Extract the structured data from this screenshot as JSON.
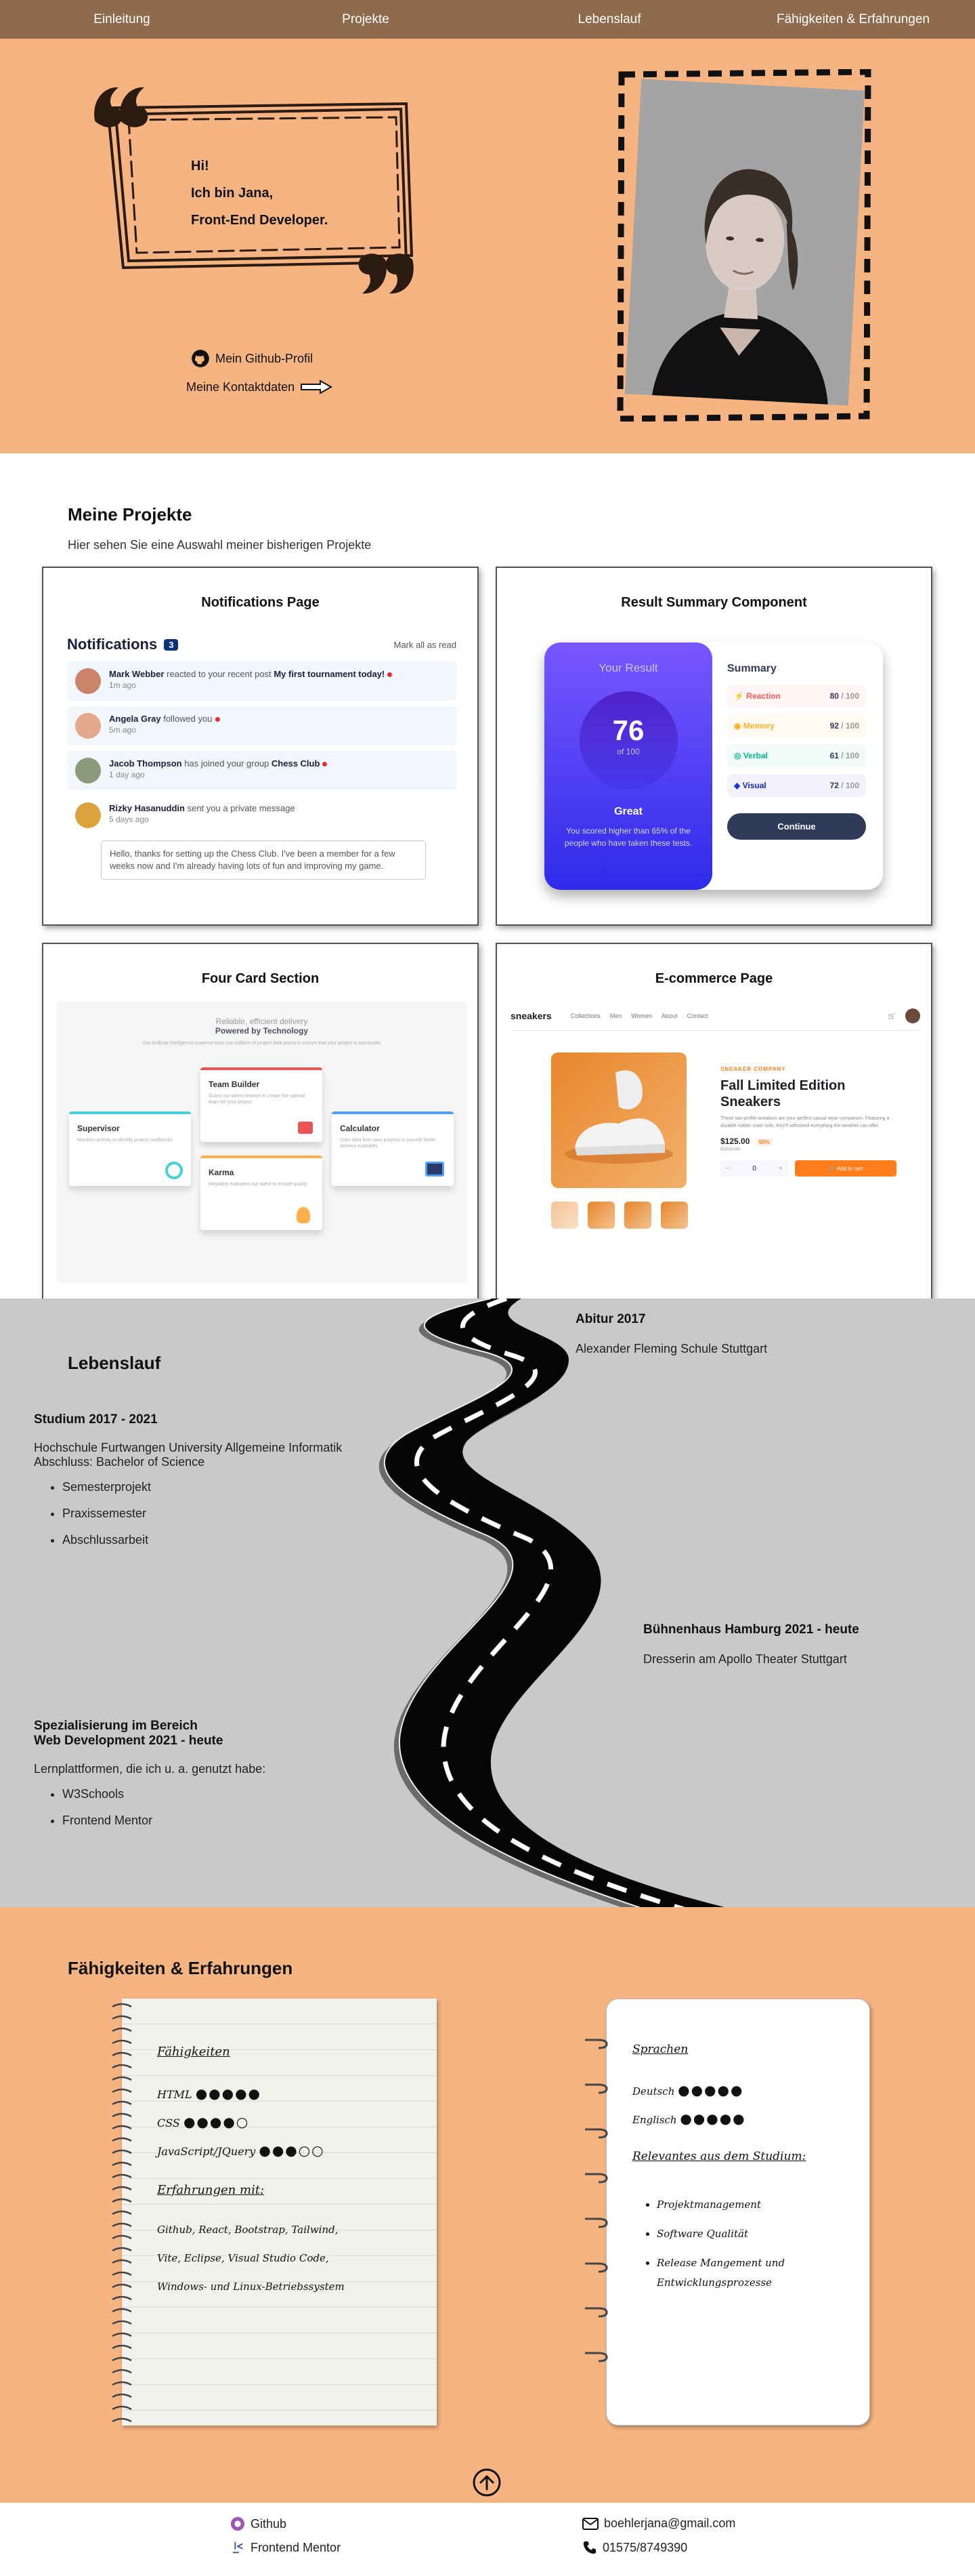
{
  "nav": {
    "items": [
      "Einleitung",
      "Projekte",
      "Lebenslauf",
      "Fähigkeiten & Erfahrungen"
    ]
  },
  "hero": {
    "greeting": "Hi!",
    "intro": "Ich bin Jana,",
    "role": "Front-End Developer.",
    "github_link": "Mein Github-Profil",
    "contact_link": "Meine Kontaktdaten"
  },
  "projects": {
    "title": "Meine Projekte",
    "subtitle": "Hier sehen Sie eine Auswahl meiner bisherigen Projekte",
    "cards": [
      {
        "title": "Notifications Page"
      },
      {
        "title": "Result Summary Component"
      },
      {
        "title": "Four Card Section"
      },
      {
        "title": "E-commerce Page"
      }
    ],
    "notifications": {
      "heading": "Notifications",
      "count": "3",
      "mark_all": "Mark all as read",
      "items": [
        {
          "name": "Mark Webber",
          "action": "reacted to your recent post",
          "target": "My first tournament today!",
          "time": "1m ago",
          "color": "#c9846a"
        },
        {
          "name": "Angela Gray",
          "action": "followed you",
          "target": "",
          "time": "5m ago",
          "color": "#e2a98d"
        },
        {
          "name": "Jacob Thompson",
          "action": "has joined your group",
          "target": "Chess Club",
          "time": "1 day ago",
          "color": "#8a9a7a"
        },
        {
          "name": "Rizky Hasanuddin",
          "action": "sent you a private message",
          "target": "",
          "time": "5 days ago",
          "color": "#d9a23a"
        }
      ],
      "message": "Hello, thanks for setting up the Chess Club. I've been a member for a few weeks now and I'm already having lots of fun and improving my game."
    },
    "result": {
      "heading": "Your Result",
      "score": "76",
      "of": "of 100",
      "grade": "Great",
      "text": "You scored higher than 65% of the people who have taken these tests.",
      "summary_title": "Summary",
      "rows": [
        {
          "label": "Reaction",
          "value": "80",
          "max": "/ 100",
          "color": "#ff5757",
          "bg": "#fff6f5"
        },
        {
          "label": "Memory",
          "value": "92",
          "max": "/ 100",
          "color": "#ffb01f",
          "bg": "#fffbf2"
        },
        {
          "label": "Verbal",
          "value": "61",
          "max": "/ 100",
          "color": "#00bb8f",
          "bg": "#f2fbfa"
        },
        {
          "label": "Visual",
          "value": "72",
          "max": "/ 100",
          "color": "#1125d6",
          "bg": "#f3f3fd"
        }
      ],
      "button": "Continue"
    },
    "fourcard": {
      "line1": "Reliable, efficient delivery",
      "line2": "Powered by Technology",
      "desc": "Our Artificial Intelligence powered tools use millions of project data points to ensure that your project is successful",
      "cards": [
        {
          "title": "Supervisor",
          "text": "Monitors activity to identify project roadblocks",
          "color": "#44d3d2"
        },
        {
          "title": "Team Builder",
          "text": "Scans our talent network to create the optimal team for your project",
          "color": "#ea5454"
        },
        {
          "title": "Karma",
          "text": "Regularly evaluates our talent to ensure quality",
          "color": "#fcaf4a"
        },
        {
          "title": "Calculator",
          "text": "Uses data from past projects to provide better delivery estimates",
          "color": "#549ef2"
        }
      ]
    },
    "ecommerce": {
      "logo": "sneakers",
      "menu": [
        "Collections",
        "Men",
        "Women",
        "About",
        "Contact"
      ],
      "company": "SNEAKER COMPANY",
      "product": "Fall Limited Edition Sneakers",
      "desc": "These low-profile sneakers are your perfect casual wear companion. Featuring a durable rubber outer sole, they'll withstand everything the weather can offer.",
      "price": "$125.00",
      "discount": "50%",
      "old_price": "$250.00",
      "qty": "0",
      "cart": "Add to cart"
    }
  },
  "cv": {
    "title": "Lebenslauf",
    "abitur_title": "Abitur 2017",
    "abitur_school": "Alexander Fleming Schule Stuttgart",
    "studium_title": "Studium 2017 - 2021",
    "studium_line1": "Hochschule Furtwangen University Allgemeine Informatik",
    "studium_line2": "Abschluss: Bachelor of Science",
    "studium_items": [
      "Semesterprojekt",
      "Praxissemester",
      "Abschlussarbeit"
    ],
    "buehne_title": "Bühnenhaus Hamburg 2021 - heute",
    "buehne_text": "Dresserin am Apollo Theater Stuttgart",
    "spez_title1": "Spezialisierung im Bereich",
    "spez_title2": "Web Development 2021 - heute",
    "spez_text": "Lernplattformen, die ich u. a. genutzt habe:",
    "spez_items": [
      "W3Schools",
      "Frontend Mentor"
    ]
  },
  "skills": {
    "title": "Fähigkeiten & Erfahrungen",
    "left_heading": "Fähigkeiten",
    "rows": [
      {
        "label": "HTML",
        "dots": "●●●●●"
      },
      {
        "label": "CSS",
        "dots": "●●●●○"
      },
      {
        "label": "JavaScript/JQuery",
        "dots": "●●●○○"
      }
    ],
    "exp_heading": "Erfahrungen mit:",
    "exp_lines": [
      "Github, React, Bootstrap, Tailwind,",
      "Vite, Eclipse, Visual Studio Code,",
      "Windows- und Linux-Betriebssystem"
    ],
    "lang_heading": "Sprachen",
    "langs": [
      {
        "label": "Deutsch",
        "dots": "●●●●●"
      },
      {
        "label": "Englisch",
        "dots": "●●●●●"
      }
    ],
    "rel_heading": "Relevantes aus dem Studium:",
    "rel_items": [
      "Projektmanagement",
      "Software Qualität",
      "Release Mangement und"
    ],
    "rel_cont": "Entwicklungsprozesse"
  },
  "footer": {
    "github": "Github",
    "frontend": "Frontend Mentor",
    "email": "boehlerjana@gmail.com",
    "phone": "01575/8749390"
  }
}
